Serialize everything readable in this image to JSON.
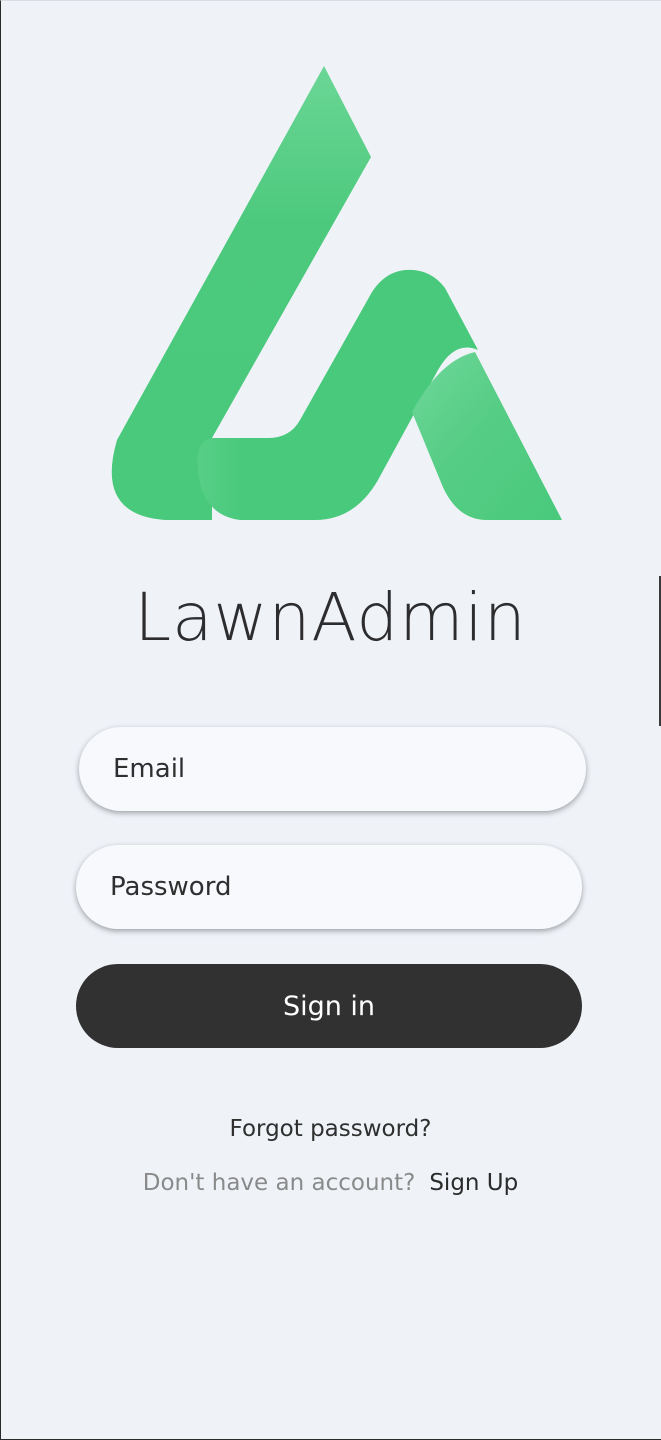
{
  "app": {
    "title": "LawnAdmin"
  },
  "logo": {
    "icon": "lawnadmin-logo-icon",
    "color_primary": "#49c97c",
    "color_light": "#6bd696"
  },
  "form": {
    "email_placeholder": "Email",
    "password_placeholder": "Password",
    "signin_label": "Sign in"
  },
  "links": {
    "forgot_password": "Forgot password?",
    "no_account_prompt": "Don't have an account?",
    "signup_label": "Sign Up"
  },
  "colors": {
    "background": "#eff3f8",
    "button": "#313131",
    "text": "#2d2d2f",
    "muted_text": "#8a8a8a"
  }
}
